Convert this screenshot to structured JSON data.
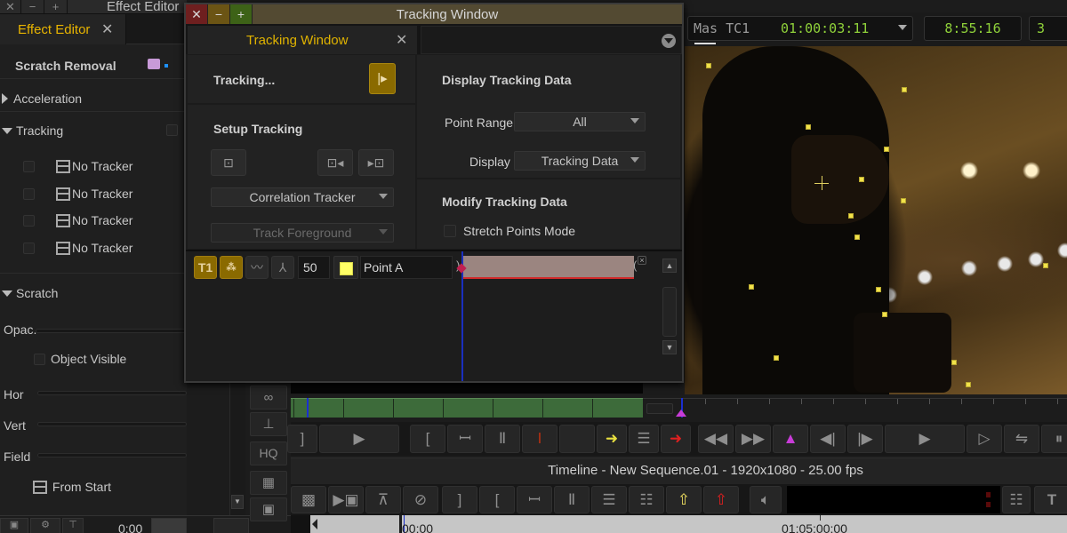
{
  "effect_editor": {
    "window_title": "Effect Editor",
    "window_controls": [
      "close",
      "minimize",
      "maximize"
    ],
    "tab_label": "Effect Editor",
    "effect_name": "Scratch Removal",
    "sections": {
      "acceleration": "Acceleration",
      "tracking": "Tracking",
      "scratch": "Scratch"
    },
    "trackers": [
      {
        "label": "No Tracker",
        "checked": false
      },
      {
        "label": "No Tracker",
        "checked": false
      },
      {
        "label": "No Tracker",
        "checked": false
      },
      {
        "label": "No Tracker",
        "checked": false
      }
    ],
    "params": {
      "opacity_label": "Opac.",
      "object_visible_label": "Object Visible",
      "object_visible_checked": false,
      "hor_label": "Hor",
      "vert_label": "Vert",
      "field_label": "Field",
      "from_start_label": "From Start"
    },
    "bottom_time": "0:00"
  },
  "tool_column": {
    "hq_label": "HQ"
  },
  "tracking_window": {
    "title": "Tracking Window",
    "tab_label": "Tracking Window",
    "tracking_status": "Tracking...",
    "setup_heading": "Setup Tracking",
    "tracker_type": "Correlation Tracker",
    "track_mode": "Track Foreground",
    "display_heading": "Display Tracking Data",
    "point_range_label": "Point Range",
    "point_range_value": "All",
    "display_label": "Display",
    "display_value": "Tracking Data",
    "modify_heading": "Modify Tracking Data",
    "stretch_points_label": "Stretch Points Mode",
    "stretch_points_checked": false,
    "track_row": {
      "track_label": "T1",
      "value": "50",
      "point_color": "#ffff66",
      "point_name": "Point A"
    }
  },
  "monitor": {
    "tc_label": "Mas TC1",
    "tc_value": "01:00:03:11",
    "duration": "8:55:16",
    "third_box": "3",
    "tc_color": "#8fd13a"
  },
  "timeline": {
    "title": "Timeline - New Sequence.01 - 1920x1080 - 25.00 fps",
    "ruler_start": "00:00",
    "ruler_mark": "01:05:00:00"
  },
  "colors": {
    "accent_gold": "#e0b300",
    "playhead_blue": "#1b2fd0",
    "marker_magenta": "#c83cd8",
    "green_track": "#3d6b3a"
  }
}
